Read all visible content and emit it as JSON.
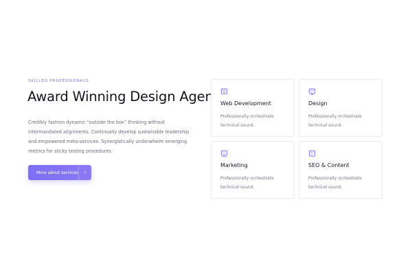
{
  "hero": {
    "eyebrow": "SKILLED PROFESSIONALS",
    "title": "Award Winning Design Agency",
    "description": "Credibly fashion dynamic “outside the box” thinking without intermandated alignments. Continually develop sustainable leadership and empowered meta-services. Synergistically underwhelm emerging metrics for sticky testing procedures.",
    "cta_label": "More about services",
    "cta_arrow": "›"
  },
  "services": [
    {
      "title": "Web Development",
      "text": "Professionally orchestrate technical sound.",
      "icon": "web-development-icon"
    },
    {
      "title": "Design",
      "text": "Professionally orchestrate technical sound.",
      "icon": "design-icon"
    },
    {
      "title": "Marketing",
      "text": "Professionally orchestrate technical sound.",
      "icon": "marketing-icon"
    },
    {
      "title": "SEO & Content",
      "text": "Professionally orchestrate technical sound.",
      "icon": "seo-content-icon"
    }
  ],
  "colors": {
    "accent": "#7b6ff2",
    "card_border": "#ececf2",
    "heading": "#14141f",
    "body": "#6b6b7e"
  }
}
